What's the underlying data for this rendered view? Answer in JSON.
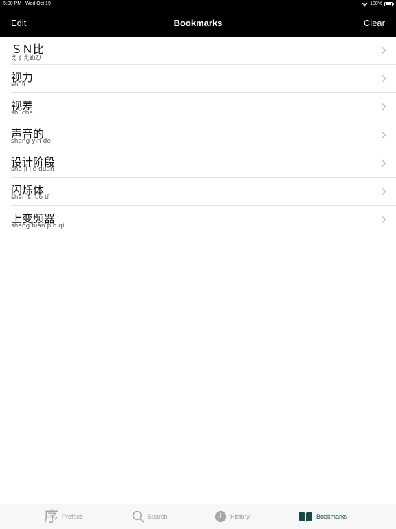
{
  "status_bar": {
    "time": "5:00 PM",
    "date": "Wed Oct 19",
    "battery": "100%"
  },
  "nav_bar": {
    "left_label": "Edit",
    "title": "Bookmarks",
    "right_label": "Clear"
  },
  "bookmarks": [
    {
      "word": "ＳＮ比",
      "reading": "えすえぬひ"
    },
    {
      "word": "视力",
      "reading": "shì lì"
    },
    {
      "word": "视差",
      "reading": "shì chā"
    },
    {
      "word": "声音的",
      "reading": "shēng yīn de"
    },
    {
      "word": "设计阶段",
      "reading": "shè jì jiē duàn"
    },
    {
      "word": "闪烁体",
      "reading": "shǎn shuò tǐ"
    },
    {
      "word": "上变频器",
      "reading": "shàng biàn pín qì"
    }
  ],
  "tab_bar": {
    "tabs": [
      {
        "label": "Preface",
        "icon_glyph": "序",
        "icon": "preface-icon"
      },
      {
        "label": "Search",
        "icon": "search-icon"
      },
      {
        "label": "History",
        "icon": "clock-icon"
      },
      {
        "label": "Bookmarks",
        "icon": "book-icon"
      }
    ],
    "active_index": 3
  },
  "colors": {
    "nav_background": "#000000",
    "active_tab": "#184a45",
    "inactive_tab": "#9b9b9b"
  }
}
